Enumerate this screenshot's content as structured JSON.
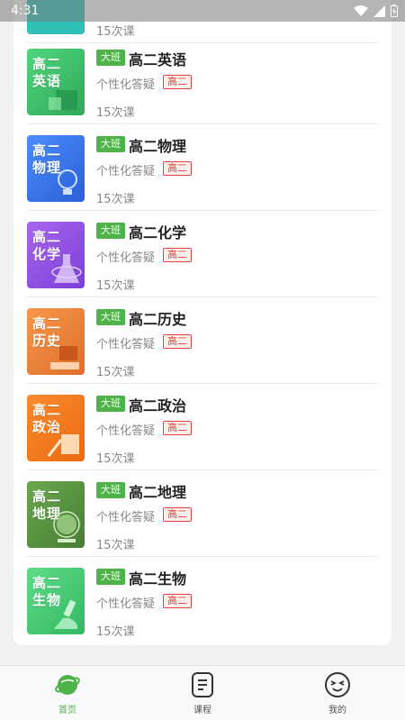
{
  "status_bar": {
    "time": "4:31"
  },
  "partial_top": {
    "count": "15次课"
  },
  "courses": [
    {
      "thumb_line1": "高二",
      "thumb_line2": "英语",
      "badge": "大班",
      "title": "高二英语",
      "subtitle": "个性化答疑",
      "grade": "高二",
      "count": "15次课",
      "color": "#3dc26a",
      "icon": "cube-icon"
    },
    {
      "thumb_line1": "高二",
      "thumb_line2": "物理",
      "badge": "大班",
      "title": "高二物理",
      "subtitle": "个性化答疑",
      "grade": "高二",
      "count": "15次课",
      "color": "#3d78f0",
      "icon": "bulb-icon"
    },
    {
      "thumb_line1": "高二",
      "thumb_line2": "化学",
      "badge": "大班",
      "title": "高二化学",
      "subtitle": "个性化答疑",
      "grade": "高二",
      "count": "15次课",
      "color": "#9a52e6",
      "icon": "flask-icon"
    },
    {
      "thumb_line1": "高二",
      "thumb_line2": "历史",
      "badge": "大班",
      "title": "高二历史",
      "subtitle": "个性化答疑",
      "grade": "高二",
      "count": "15次课",
      "color": "#f08a3a",
      "icon": "books-icon"
    },
    {
      "thumb_line1": "高二",
      "thumb_line2": "政治",
      "badge": "大班",
      "title": "高二政治",
      "subtitle": "个性化答疑",
      "grade": "高二",
      "count": "15次课",
      "color": "#f47c24",
      "icon": "pencil-icon"
    },
    {
      "thumb_line1": "高二",
      "thumb_line2": "地理",
      "badge": "大班",
      "title": "高二地理",
      "subtitle": "个性化答疑",
      "grade": "高二",
      "count": "15次课",
      "color": "#5c9a45",
      "icon": "globe-icon"
    },
    {
      "thumb_line1": "高二",
      "thumb_line2": "生物",
      "badge": "大班",
      "title": "高二生物",
      "subtitle": "个性化答疑",
      "grade": "高二",
      "count": "15次课",
      "color": "#4fcf7a",
      "icon": "microscope-icon"
    }
  ],
  "bottom_nav": {
    "home": "首页",
    "courses": "课程",
    "mine": "我的"
  },
  "colors": {
    "accent": "#4fb34c",
    "grade_tag": "#e0433f"
  }
}
